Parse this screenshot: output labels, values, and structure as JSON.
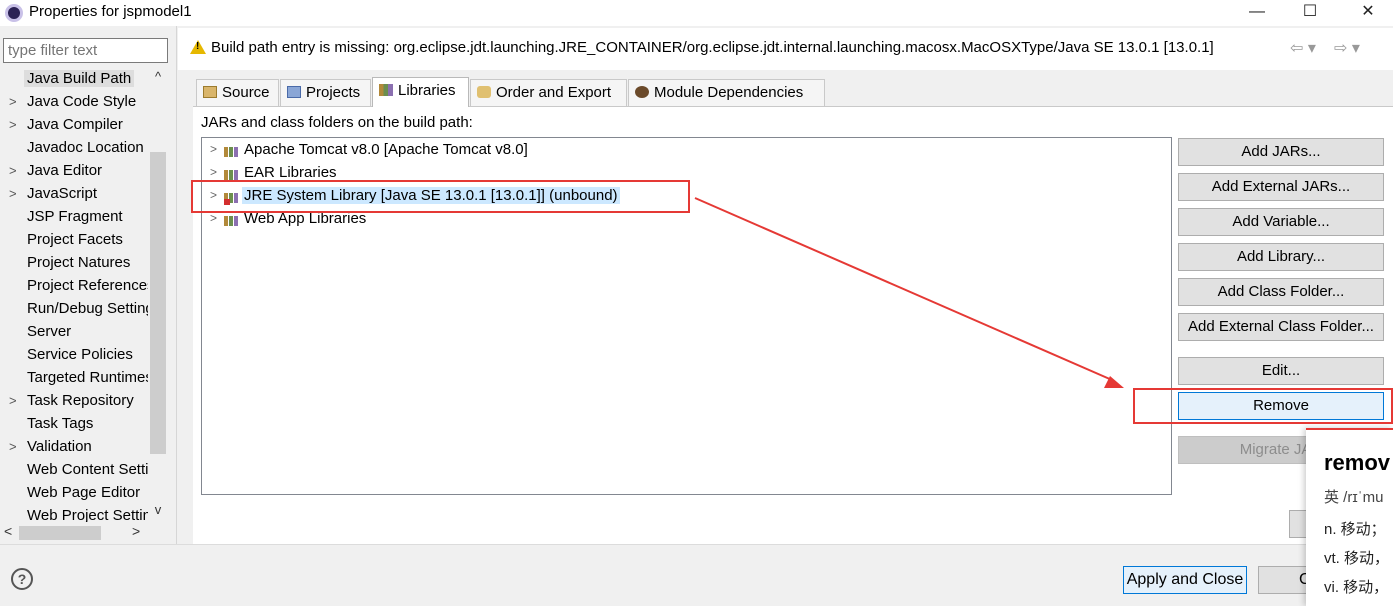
{
  "window": {
    "title": "Properties for jspmodel1",
    "controls": {
      "minimize": "—",
      "maximize": "☐",
      "close": "✕"
    }
  },
  "filter": {
    "placeholder": "type filter text"
  },
  "left_tree": {
    "items": [
      {
        "label": "Java Build Path",
        "expandable": false,
        "selected": true
      },
      {
        "label": "Java Code Style",
        "expandable": true
      },
      {
        "label": "Java Compiler",
        "expandable": true
      },
      {
        "label": "Javadoc Location",
        "expandable": false
      },
      {
        "label": "Java Editor",
        "expandable": true
      },
      {
        "label": "JavaScript",
        "expandable": true
      },
      {
        "label": "JSP Fragment",
        "expandable": false
      },
      {
        "label": "Project Facets",
        "expandable": false
      },
      {
        "label": "Project Natures",
        "expandable": false
      },
      {
        "label": "Project References",
        "expandable": false
      },
      {
        "label": "Run/Debug Settings",
        "expandable": false
      },
      {
        "label": "Server",
        "expandable": false
      },
      {
        "label": "Service Policies",
        "expandable": false
      },
      {
        "label": "Targeted Runtimes",
        "expandable": false
      },
      {
        "label": "Task Repository",
        "expandable": true
      },
      {
        "label": "Task Tags",
        "expandable": false
      },
      {
        "label": "Validation",
        "expandable": true
      },
      {
        "label": "Web Content Settings",
        "expandable": false
      },
      {
        "label": "Web Page Editor",
        "expandable": false
      },
      {
        "label": "Web Project Settings",
        "expandable": false
      }
    ],
    "scroll_up": "^",
    "scroll_down": "v",
    "scroll_left": "<",
    "scroll_right": ">"
  },
  "message": {
    "text": "Build path entry is missing: org.eclipse.jdt.launching.JRE_CONTAINER/org.eclipse.jdt.internal.launching.macosx.MacOSXType/Java SE 13.0.1 [13.0.1]",
    "warning_icon": "warning-icon",
    "warning_mark": "!",
    "nav_back": "⇦ ▾",
    "nav_forward": "⇨ ▾"
  },
  "tabs": [
    {
      "label": "Source",
      "icon": "source-folder-icon"
    },
    {
      "label": "Projects",
      "icon": "projects-icon"
    },
    {
      "label": "Libraries",
      "icon": "libraries-icon",
      "active": true
    },
    {
      "label": "Order and Export",
      "icon": "order-export-icon"
    },
    {
      "label": "Module Dependencies",
      "icon": "module-dependencies-icon"
    }
  ],
  "libraries": {
    "label": "JARs and class folders on the build path:",
    "items": [
      {
        "label": "Apache Tomcat v8.0 [Apache Tomcat v8.0]"
      },
      {
        "label": "EAR Libraries"
      },
      {
        "label": "JRE System Library [Java SE 13.0.1 [13.0.1]] (unbound)",
        "selected": true,
        "error": true
      },
      {
        "label": "Web App Libraries"
      }
    ],
    "expand_arrow": ">"
  },
  "buttons": {
    "add_jars": "Add JARs...",
    "add_external_jars": "Add External JARs...",
    "add_variable": "Add Variable...",
    "add_library": "Add Library...",
    "add_class_folder": "Add Class Folder...",
    "add_external_class_folder": "Add External Class Folder...",
    "edit": "Edit...",
    "remove": "Remove",
    "migrate_jar": "Migrate JAR"
  },
  "bottom": {
    "help": "?",
    "apply_and_close": "Apply and Close",
    "cancel_partial": "C"
  },
  "dictionary_popup": {
    "word": "remov",
    "phonetic": "英 /rɪˈmu",
    "defs": [
      "n. 移动；",
      "vt. 移动，",
      "vi. 移动，"
    ]
  },
  "colors": {
    "annotation_red": "#e53935",
    "selection_blue": "#cce8ff",
    "focus_border": "#0078d7"
  }
}
